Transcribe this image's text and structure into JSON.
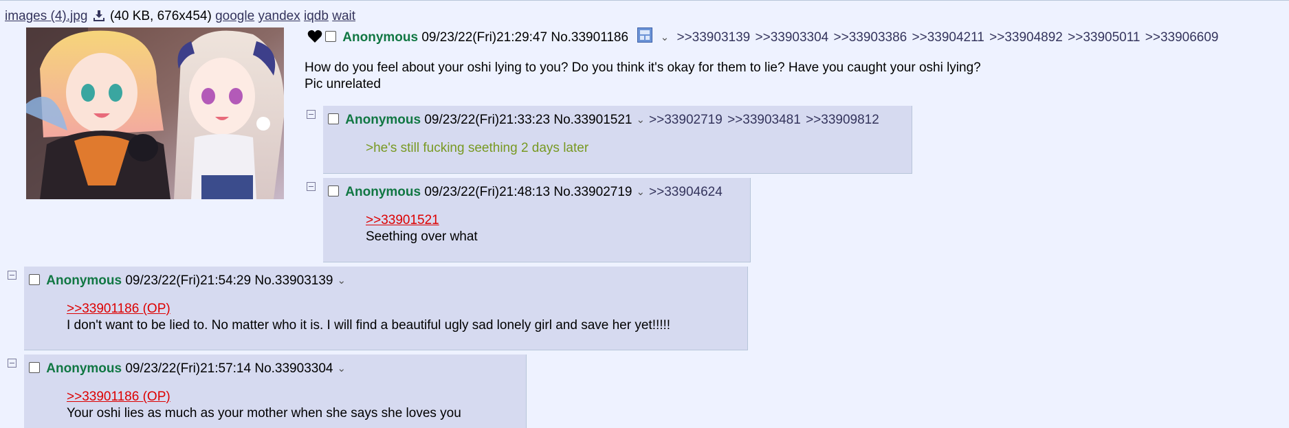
{
  "file": {
    "filename": "images (4).jpg",
    "meta": "(40 KB, 676x454)",
    "links": [
      "google",
      "yandex",
      "iqdb",
      "wait"
    ]
  },
  "op": {
    "name": "Anonymous",
    "datetime": "09/23/22(Fri)21:29:47",
    "number": "No.33901186",
    "backlinks": [
      ">>33903139",
      ">>33903304",
      ">>33903386",
      ">>33904211",
      ">>33904892",
      ">>33905011",
      ">>33906609"
    ],
    "message_line1": "How do you feel about your oshi lying to you? Do you think it's okay for them to lie? Have you caught your oshi lying?",
    "message_line2": "Pic unrelated"
  },
  "replies": [
    {
      "name": "Anonymous",
      "datetime": "09/23/22(Fri)21:33:23",
      "number": "No.33901521",
      "backlinks": [
        ">>33902719",
        ">>33903481",
        ">>33909812"
      ],
      "greentext": ">he's still fucking seething 2 days later"
    },
    {
      "name": "Anonymous",
      "datetime": "09/23/22(Fri)21:48:13",
      "number": "No.33902719",
      "backlinks": [
        ">>33904624"
      ],
      "quote": ">>33901521",
      "text": "Seething over what"
    },
    {
      "name": "Anonymous",
      "datetime": "09/23/22(Fri)21:54:29",
      "number": "No.33903139",
      "backlinks": [],
      "quote": ">>33901186 (OP)",
      "text": "I don't want to be lied to. No matter who it is. I will find a beautiful ugly sad lonely girl and save her yet!!!!!"
    },
    {
      "name": "Anonymous",
      "datetime": "09/23/22(Fri)21:57:14",
      "number": "No.33903304",
      "backlinks": [],
      "quote": ">>33901186 (OP)",
      "text": "Your oshi lies as much as your mother when she says she loves you"
    }
  ],
  "colors": {
    "background": "#eef2ff",
    "reply_background": "#d6daf0",
    "name": "#117743",
    "greentext": "#789922",
    "quotelink": "#dd0000"
  },
  "icons": [
    "download-icon",
    "heart-icon",
    "image-search-icon",
    "chevron-down-icon",
    "minus-box-icon"
  ]
}
